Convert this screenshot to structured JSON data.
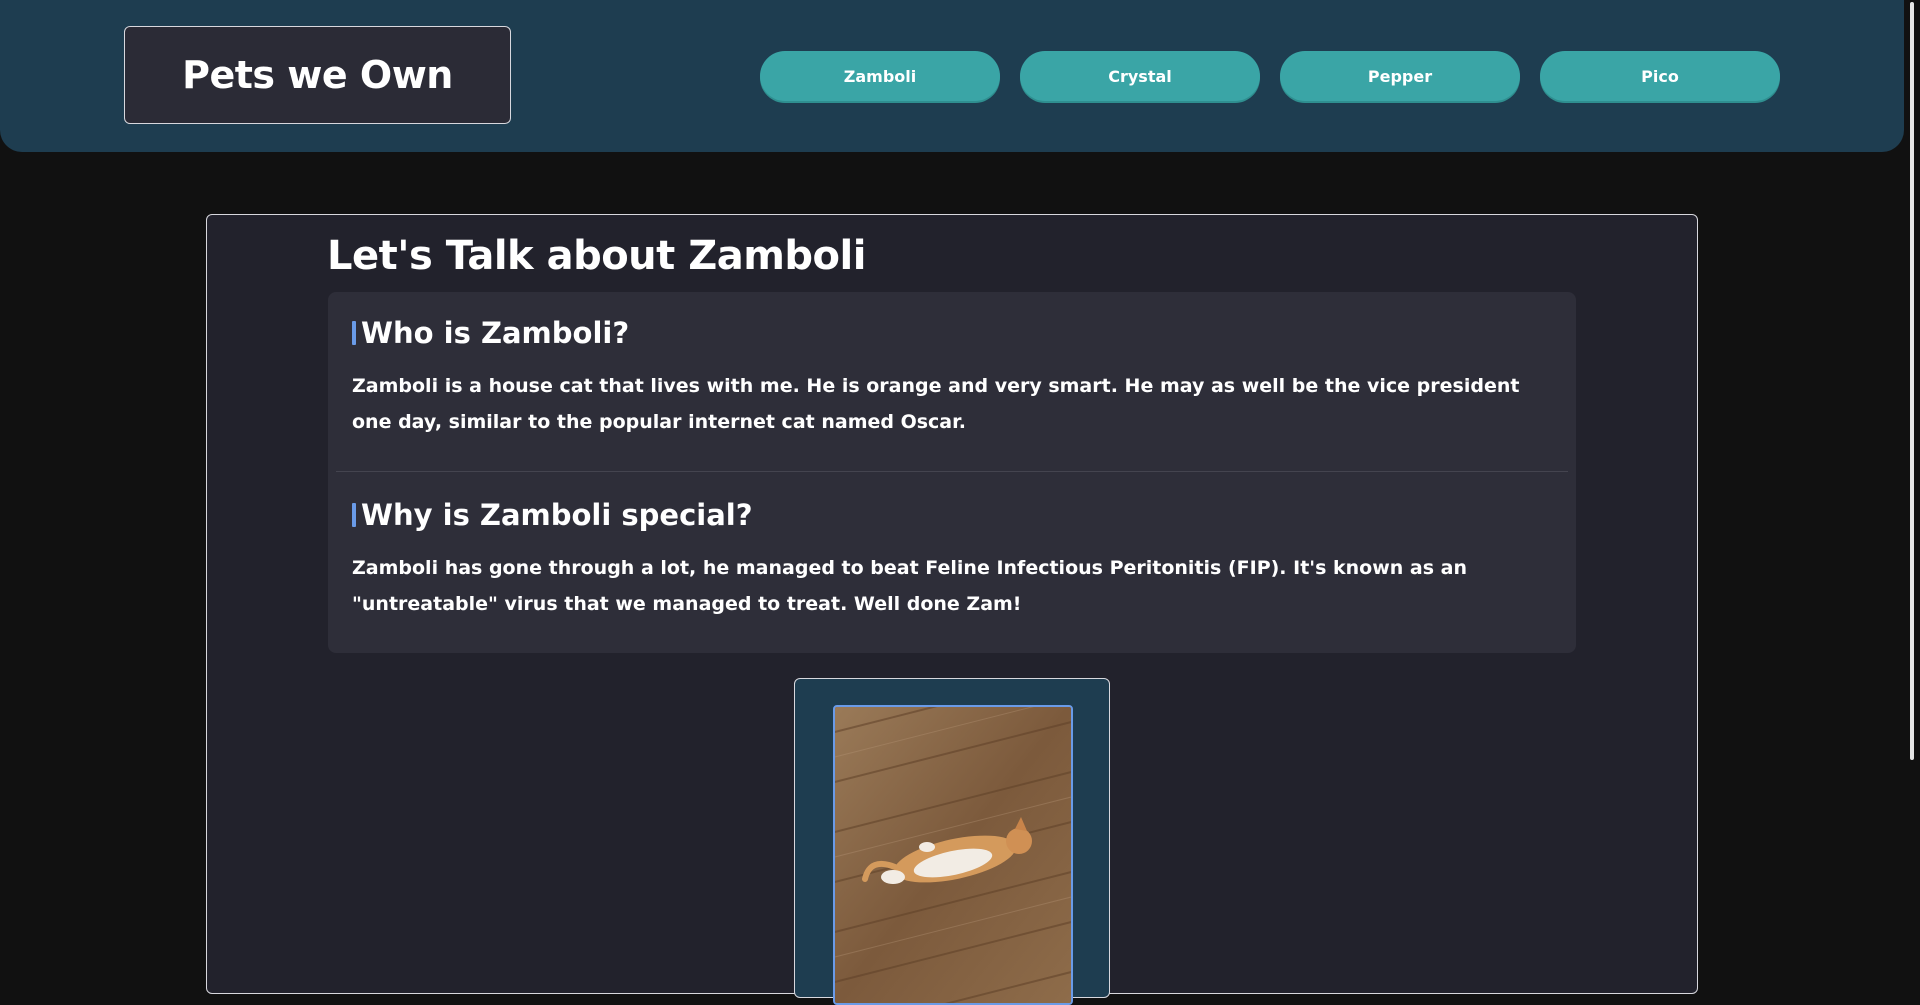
{
  "header": {
    "brand_title": "Pets we Own",
    "nav": [
      {
        "label": "Zamboli"
      },
      {
        "label": "Crystal"
      },
      {
        "label": "Pepper"
      },
      {
        "label": "Pico"
      }
    ]
  },
  "main": {
    "title": "Let's Talk about Zamboli",
    "sections": [
      {
        "heading": "Who is Zamboli?",
        "body": "Zamboli is a house cat that lives with me. He is orange and very smart. He may as well be the vice president one day, similar to the popular internet cat named Oscar."
      },
      {
        "heading": "Why is Zamboli special?",
        "body": "Zamboli has gone through a lot, he managed to beat Feline Infectious Peritonitis (FIP). It's known as an \"untreatable\" virus that we managed to treat. Well done Zam!"
      }
    ],
    "photo": {
      "subject": "orange-cat-lying-on-wood-floor"
    }
  },
  "colors": {
    "page_bg": "#111111",
    "header_bg": "#1e3d50",
    "nav_button": "#3aa5a6",
    "card_bg": "#2e2e39",
    "content_bg": "#22222c",
    "accent": "#6a9be8"
  }
}
